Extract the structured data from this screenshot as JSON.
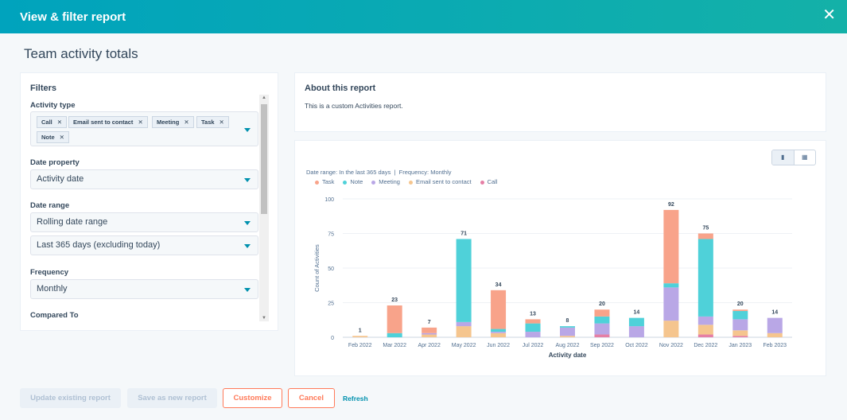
{
  "modal": {
    "title": "View & filter report",
    "close_icon": "close-icon"
  },
  "page_title": "Team activity totals",
  "filters": {
    "heading": "Filters",
    "activity_type_label": "Activity type",
    "activity_types": [
      "Call",
      "Email sent to contact",
      "Meeting",
      "Task",
      "Note"
    ],
    "date_property_label": "Date property",
    "date_property": "Activity date",
    "date_range_label": "Date range",
    "date_range_type": "Rolling date range",
    "date_range": "Last 365 days (excluding today)",
    "frequency_label": "Frequency",
    "frequency": "Monthly",
    "compared_to_label": "Compared To"
  },
  "about": {
    "heading": "About this report",
    "text": "This is a custom Activities report."
  },
  "chart_meta": {
    "date_range": "Date range: In the last 365 days",
    "frequency": "Frequency: Monthly",
    "toggle": [
      "bar-chart-icon",
      "table-icon"
    ]
  },
  "chart_data": {
    "type": "bar",
    "stacked": true,
    "xlabel": "Activity date",
    "ylabel": "Count of Activities",
    "ylim": [
      0,
      100
    ],
    "yticks": [
      0,
      25,
      50,
      75,
      100
    ],
    "grid": true,
    "legend": "top-left",
    "categories": [
      "Feb 2022",
      "Mar 2022",
      "Apr 2022",
      "May 2022",
      "Jun 2022",
      "Jul 2022",
      "Aug 2022",
      "Sep 2022",
      "Oct 2022",
      "Nov 2022",
      "Dec 2022",
      "Jan 2023",
      "Feb 2023"
    ],
    "totals": [
      1,
      23,
      7,
      71,
      34,
      13,
      8,
      20,
      14,
      92,
      75,
      20,
      14
    ],
    "series": [
      {
        "name": "Call",
        "color": "#e57fa5",
        "values": [
          0,
          0,
          0,
          0,
          0,
          0,
          0,
          2,
          0,
          0,
          2,
          1,
          0
        ]
      },
      {
        "name": "Email sent to contact",
        "color": "#f5c58e",
        "values": [
          1,
          0,
          2,
          8,
          3,
          0,
          1,
          0,
          0,
          12,
          7,
          4,
          3
        ]
      },
      {
        "name": "Meeting",
        "color": "#b9a7e6",
        "values": [
          0,
          0,
          1,
          3,
          1,
          4,
          6,
          8,
          8,
          24,
          6,
          8,
          11
        ]
      },
      {
        "name": "Note",
        "color": "#4fd1d9",
        "values": [
          0,
          3,
          0,
          60,
          2,
          6,
          1,
          5,
          6,
          3,
          56,
          6,
          0
        ]
      },
      {
        "name": "Task",
        "color": "#f8a38a",
        "values": [
          0,
          20,
          4,
          0,
          28,
          3,
          0,
          5,
          0,
          53,
          4,
          1,
          0
        ]
      }
    ],
    "legend_order": [
      "Task",
      "Note",
      "Meeting",
      "Email sent to contact",
      "Call"
    ]
  },
  "footer": {
    "update": "Update existing report",
    "save": "Save as new report",
    "customize": "Customize",
    "cancel": "Cancel",
    "refresh": "Refresh"
  }
}
